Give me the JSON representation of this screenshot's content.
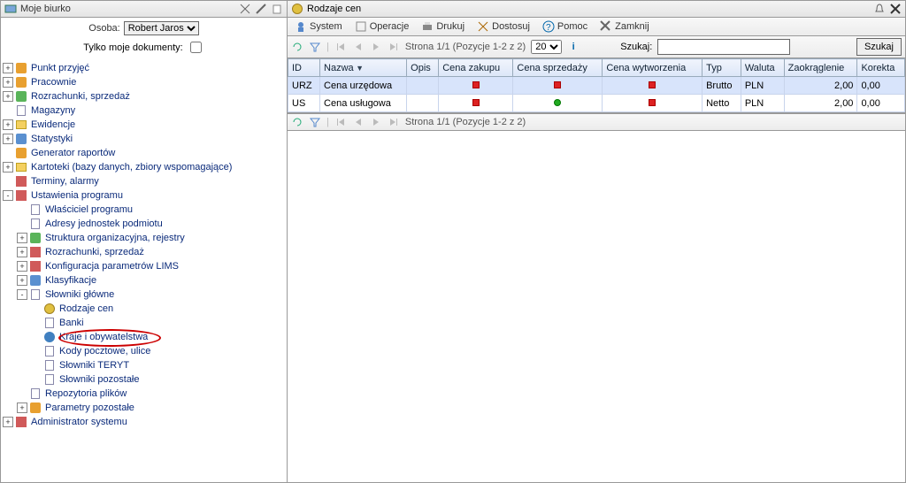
{
  "left": {
    "title": "Moje biurko",
    "person_label": "Osoba:",
    "person_value": "Robert Jaros",
    "only_my_docs_label": "Tylko moje dokumenty:"
  },
  "tree": [
    {
      "label": "Punkt przyjęć",
      "exp": "+",
      "icon": "ic-orange"
    },
    {
      "label": "Pracownie",
      "exp": "+",
      "icon": "ic-orange"
    },
    {
      "label": "Rozrachunki, sprzedaż",
      "exp": "+",
      "icon": "ic-green"
    },
    {
      "label": "Magazyny",
      "exp": "",
      "icon": "ic-page"
    },
    {
      "label": "Ewidencje",
      "exp": "+",
      "icon": "ic-fold"
    },
    {
      "label": "Statystyki",
      "exp": "+",
      "icon": "ic-blue"
    },
    {
      "label": "Generator raportów",
      "exp": "",
      "icon": "ic-orange"
    },
    {
      "label": "Kartoteki (bazy danych, zbiory wspomagające)",
      "exp": "+",
      "icon": "ic-fold"
    },
    {
      "label": "Terminy, alarmy",
      "exp": "",
      "icon": "ic-red"
    },
    {
      "label": "Ustawienia programu",
      "exp": "-",
      "icon": "ic-red",
      "children": [
        {
          "label": "Właściciel programu",
          "exp": "",
          "icon": "ic-page"
        },
        {
          "label": "Adresy jednostek podmiotu",
          "exp": "",
          "icon": "ic-page"
        },
        {
          "label": "Struktura organizacyjna, rejestry",
          "exp": "+",
          "icon": "ic-green"
        },
        {
          "label": "Rozrachunki, sprzedaż",
          "exp": "+",
          "icon": "ic-red"
        },
        {
          "label": "Konfiguracja parametrów LIMS",
          "exp": "+",
          "icon": "ic-red"
        },
        {
          "label": "Klasyfikacje",
          "exp": "+",
          "icon": "ic-blue"
        },
        {
          "label": "Słowniki główne",
          "exp": "-",
          "icon": "ic-page",
          "children": [
            {
              "label": "Rodzaje cen",
              "exp": "",
              "icon": "ic-gold",
              "selected": true
            },
            {
              "label": "Banki",
              "exp": "",
              "icon": "ic-page"
            },
            {
              "label": "Kraje i obywatelstwa",
              "exp": "",
              "icon": "ic-globe"
            },
            {
              "label": "Kody pocztowe, ulice",
              "exp": "",
              "icon": "ic-page"
            },
            {
              "label": "Słowniki TERYT",
              "exp": "",
              "icon": "ic-page"
            },
            {
              "label": "Słowniki pozostałe",
              "exp": "",
              "icon": "ic-page"
            }
          ]
        },
        {
          "label": "Repozytoria plików",
          "exp": "",
          "icon": "ic-page"
        },
        {
          "label": "Parametry pozostałe",
          "exp": "+",
          "icon": "ic-orange"
        }
      ]
    },
    {
      "label": "Administrator systemu",
      "exp": "+",
      "icon": "ic-red"
    }
  ],
  "right": {
    "title": "Rodzaje cen",
    "toolbar": {
      "system": "System",
      "operacje": "Operacje",
      "drukuj": "Drukuj",
      "dostosuj": "Dostosuj",
      "pomoc": "Pomoc",
      "zamknij": "Zamknij"
    },
    "pager": {
      "status": "Strona 1/1 (Pozycje 1-2 z 2)",
      "page_size": "20",
      "search_label": "Szukaj:",
      "search_value": "",
      "search_btn": "Szukaj"
    },
    "grid": {
      "columns": [
        "ID",
        "Nazwa",
        "Opis",
        "Cena zakupu",
        "Cena sprzedaży",
        "Cena wytworzenia",
        "Typ",
        "Waluta",
        "Zaokrąglenie",
        "Korekta"
      ],
      "sort_col": "Nazwa",
      "rows": [
        {
          "id": "URZ",
          "nazwa": "Cena urzędowa",
          "opis": "",
          "zakup": "red",
          "sprzedaz": "red",
          "wytw": "red",
          "typ": "Brutto",
          "waluta": "PLN",
          "zaokr": "2,00",
          "korekta": "0,00",
          "sel": true
        },
        {
          "id": "US",
          "nazwa": "Cena usługowa",
          "opis": "",
          "zakup": "red",
          "sprzedaz": "green",
          "wytw": "red",
          "typ": "Netto",
          "waluta": "PLN",
          "zaokr": "2,00",
          "korekta": "0,00",
          "sel": false
        }
      ]
    },
    "pager_bottom": {
      "status": "Strona 1/1 (Pozycje 1-2 z 2)"
    }
  }
}
